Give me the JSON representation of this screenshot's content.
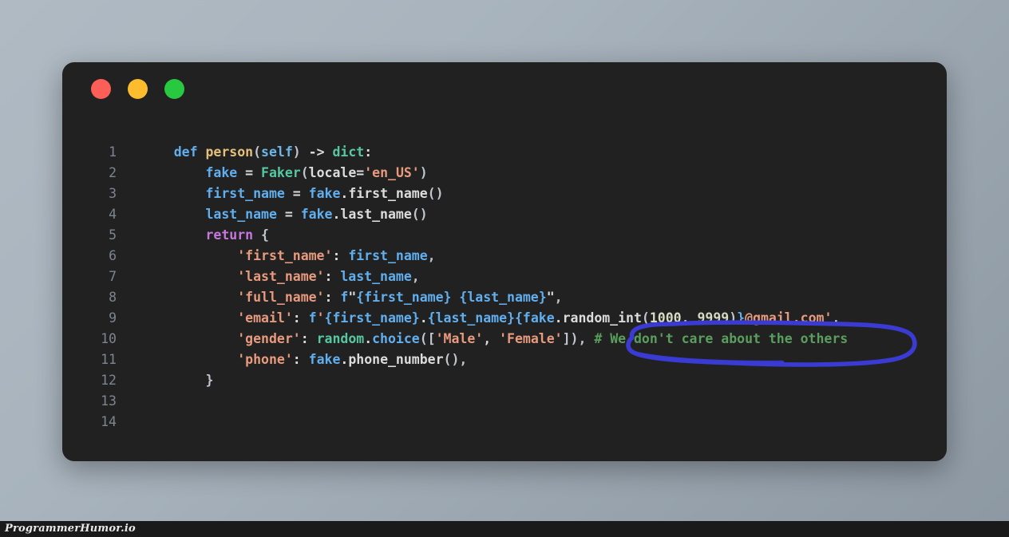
{
  "window": {
    "traffic_lights": [
      {
        "name": "close-button",
        "color": "#fc5f58"
      },
      {
        "name": "minimize-button",
        "color": "#fdbc2e"
      },
      {
        "name": "maximize-button",
        "color": "#28c840"
      }
    ]
  },
  "editor": {
    "background": "#212121",
    "language": "python",
    "line_numbers": [
      "1",
      "2",
      "3",
      "4",
      "5",
      "6",
      "7",
      "8",
      "9",
      "10",
      "11",
      "12",
      "13",
      "14"
    ],
    "lines": [
      {
        "number": "1",
        "text": "    def person(self) -> dict:"
      },
      {
        "number": "2",
        "text": "        fake = Faker(locale='en_US')"
      },
      {
        "number": "3",
        "text": "        first_name = fake.first_name()"
      },
      {
        "number": "4",
        "text": "        last_name = fake.last_name()"
      },
      {
        "number": "5",
        "text": "        return {"
      },
      {
        "number": "6",
        "text": "            'first_name': first_name,"
      },
      {
        "number": "7",
        "text": "            'last_name': last_name,"
      },
      {
        "number": "8",
        "text": "            'full_name': f\"{first_name} {last_name}\","
      },
      {
        "number": "9",
        "text": "            'email': f'{first_name}.{last_name}{fake.random_int(1000, 9999)}@gmail.com',"
      },
      {
        "number": "10",
        "text": "            'gender': random.choice(['Male', 'Female']), # We don't care about the others"
      },
      {
        "number": "11",
        "text": "            'phone': fake.phone_number(),"
      },
      {
        "number": "12",
        "text": "        }"
      },
      {
        "number": "13",
        "text": ""
      },
      {
        "number": "14",
        "text": ""
      }
    ],
    "tokens": {
      "l1": {
        "def": "def",
        "fn": "person",
        "open": "(",
        "self": "self",
        "close": ")",
        "arrow": " -> ",
        "type": "dict",
        "colon": ":"
      },
      "l2": {
        "var": "fake",
        "eq": " = ",
        "cls": "Faker",
        "open": "(",
        "kwarg": "locale",
        "assign": "=",
        "str": "'en_US'",
        "close": ")"
      },
      "l3": {
        "var": "first_name",
        "eq": " = ",
        "obj": "fake",
        "dot": ".",
        "meth": "first_name",
        "parens": "()"
      },
      "l4": {
        "var": "last_name",
        "eq": " = ",
        "obj": "fake",
        "dot": ".",
        "meth": "last_name",
        "parens": "()"
      },
      "l5": {
        "kw": "return",
        "brace": " {"
      },
      "l6": {
        "key": "'first_name'",
        "colon": ": ",
        "val": "first_name",
        "comma": ","
      },
      "l7": {
        "key": "'last_name'",
        "colon": ": ",
        "val": "last_name",
        "comma": ","
      },
      "l8": {
        "key": "'full_name'",
        "colon": ": ",
        "f": "f",
        "q": "\"",
        "e1": "{first_name}",
        "sp": " ",
        "e2": "{last_name}",
        "q2": "\"",
        "comma": ","
      },
      "l9": {
        "key": "'email'",
        "colon": ": ",
        "f": "f",
        "q": "'",
        "e1": "{first_name}",
        "dot": ".",
        "e2": "{last_name}",
        "ob": "{",
        "obj": "fake",
        "d2": ".",
        "meth": "random_int",
        "op": "(",
        "n1": "1000",
        "cm": ", ",
        "n2": "9999",
        "cp": ")",
        "cb": "}",
        "dom": "@gmail.com",
        "q2": "'",
        "comma": ","
      },
      "l10": {
        "key": "'gender'",
        "colon": ": ",
        "mod": "random",
        "dot": ".",
        "meth": "choice",
        "op": "([",
        "s1": "'Male'",
        "cm": ", ",
        "s2": "'Female'",
        "cp": "])",
        "comma": ",",
        "comment": "# We don't care about the others"
      },
      "l11": {
        "key": "'phone'",
        "colon": ": ",
        "obj": "fake",
        "dot": ".",
        "meth": "phone_number",
        "parens": "()",
        "comma": ","
      },
      "l12": {
        "brace": "}"
      }
    },
    "colors": {
      "keyword": "#61afef",
      "keyword2": "#c678dd",
      "function": "#e5c07b",
      "type": "#56c8a0",
      "string": "#e79a7e",
      "comment": "#5a9e5e",
      "number": "#d6dbc4",
      "plain": "#dcdcdc",
      "line_number": "#7d8590"
    }
  },
  "annotation": {
    "shape": "hand-drawn-ellipse",
    "color": "#3b3bd4",
    "targets_line": "10",
    "targets_text": "# We don't care about the others"
  },
  "watermark": {
    "text": "ProgrammerHumor.io"
  }
}
